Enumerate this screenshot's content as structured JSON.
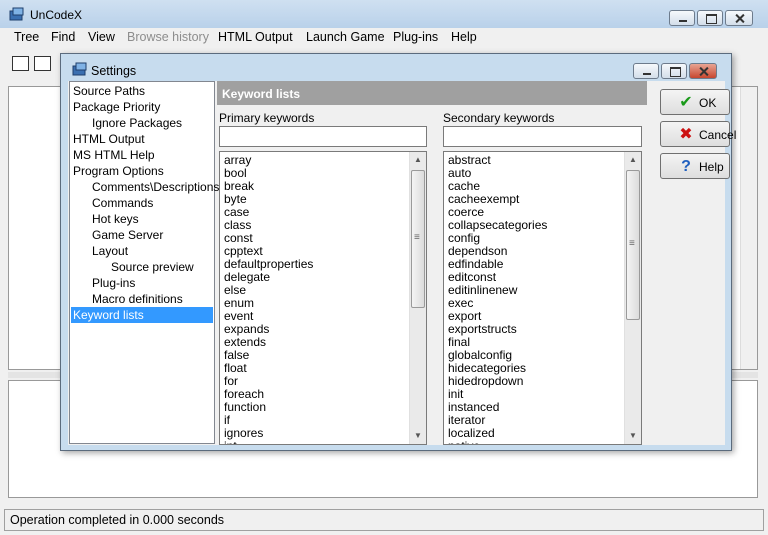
{
  "app": {
    "title": "UnCodeX"
  },
  "menu": [
    {
      "label": "Tree",
      "disabled": false
    },
    {
      "label": "Find",
      "disabled": false
    },
    {
      "label": "View",
      "disabled": false
    },
    {
      "label": "Browse history",
      "disabled": true
    },
    {
      "label": "HTML Output",
      "disabled": false
    },
    {
      "label": "Launch Game",
      "disabled": false
    },
    {
      "label": "Plug-ins",
      "disabled": false
    },
    {
      "label": "Help",
      "disabled": false
    }
  ],
  "status": {
    "text": "Operation completed in 0.000 seconds"
  },
  "dialog": {
    "title": "Settings",
    "tree": [
      {
        "label": "Source Paths",
        "level": 0
      },
      {
        "label": "Package Priority",
        "level": 0
      },
      {
        "label": "Ignore Packages",
        "level": 1
      },
      {
        "label": "HTML Output",
        "level": 0
      },
      {
        "label": "MS HTML Help",
        "level": 0
      },
      {
        "label": "Program Options",
        "level": 0
      },
      {
        "label": "Comments\\Descriptions",
        "level": 1
      },
      {
        "label": "Commands",
        "level": 1
      },
      {
        "label": "Hot keys",
        "level": 1
      },
      {
        "label": "Game Server",
        "level": 1
      },
      {
        "label": "Layout",
        "level": 1
      },
      {
        "label": "Source preview",
        "level": 2
      },
      {
        "label": "Plug-ins",
        "level": 1
      },
      {
        "label": "Macro definitions",
        "level": 1
      },
      {
        "label": "Keyword lists",
        "level": 0,
        "selected": true
      }
    ],
    "panel_title": "Keyword lists",
    "primary": {
      "label": "Primary keywords",
      "input_value": "",
      "items": [
        "array",
        "bool",
        "break",
        "byte",
        "case",
        "class",
        "const",
        "cpptext",
        "defaultproperties",
        "delegate",
        "else",
        "enum",
        "event",
        "expands",
        "extends",
        "false",
        "float",
        "for",
        "foreach",
        "function",
        "if",
        "ignores",
        "int"
      ]
    },
    "secondary": {
      "label": "Secondary keywords",
      "input_value": "",
      "items": [
        "abstract",
        "auto",
        "cache",
        "cacheexempt",
        "coerce",
        "collapsecategories",
        "config",
        "dependson",
        "edfindable",
        "editconst",
        "editinlinenew",
        "exec",
        "export",
        "exportstructs",
        "final",
        "globalconfig",
        "hidecategories",
        "hidedropdown",
        "init",
        "instanced",
        "iterator",
        "localized",
        "native"
      ]
    },
    "buttons": {
      "ok": "OK",
      "cancel": "Cancel",
      "help": "Help"
    }
  },
  "colors": {
    "selection": "#3399ff",
    "panel_header": "#a0a0a0",
    "ok_icon": "#1a9a1a",
    "cancel_icon": "#cc1111",
    "help_icon": "#1f5fbf"
  }
}
